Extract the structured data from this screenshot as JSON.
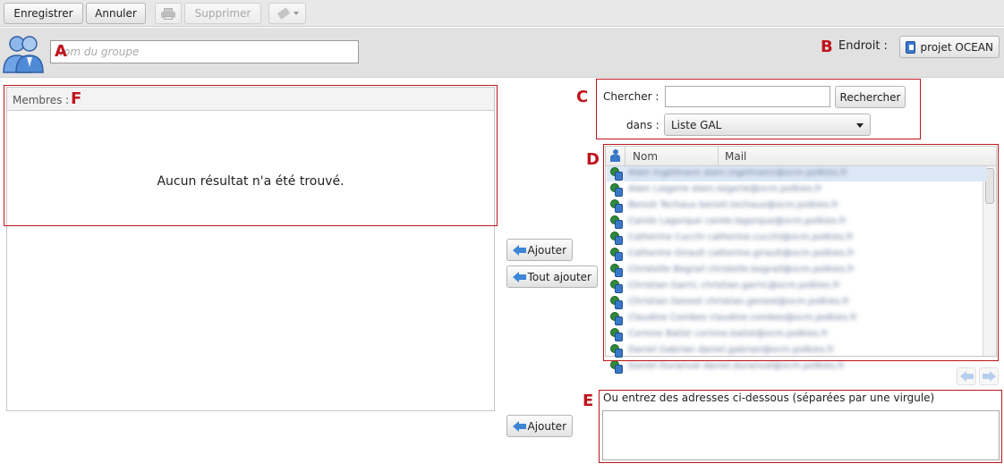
{
  "toolbar": {
    "save_label": "Enregistrer",
    "cancel_label": "Annuler",
    "delete_label": "Supprimer"
  },
  "header": {
    "group_name_placeholder": "Nom du groupe",
    "location_label": "Endroit :",
    "location_value": "projet OCEAN"
  },
  "members": {
    "header": "Membres :",
    "empty_text": "Aucun résultat n'a été trouvé."
  },
  "search": {
    "search_label": "Chercher :",
    "search_value": "",
    "search_button": "Rechercher",
    "in_label": "dans :",
    "source_selected": "Liste GAL"
  },
  "results": {
    "columns": [
      "Nom",
      "Mail"
    ],
    "rows": [
      {
        "name": "Alain Ingelmann",
        "mail": "alain.ingelmann@ocm.polkies.fr"
      },
      {
        "name": "Alain Laigerie",
        "mail": "alain.laigerie@ocm.polkies.fr"
      },
      {
        "name": "Benoit Techaux",
        "mail": "benoit.techaux@ocm.polkies.fr"
      },
      {
        "name": "Carole Lagorque",
        "mail": "carole.lagorque@ocm.polkies.fr"
      },
      {
        "name": "Catherine Cucchi",
        "mail": "catherine.cucchi@ocm.polkies.fr"
      },
      {
        "name": "Catherine Girault",
        "mail": "catherine.girault@ocm.polkies.fr"
      },
      {
        "name": "Christelle Begrail",
        "mail": "christelle.begrail@ocm.polkies.fr"
      },
      {
        "name": "Christian Garric",
        "mail": "christian.garric@ocm.polkies.fr"
      },
      {
        "name": "Christian Genest",
        "mail": "christian.genest@ocm.polkies.fr"
      },
      {
        "name": "Claudine Combes",
        "mail": "claudine.combes@ocm.polkies.fr"
      },
      {
        "name": "Corinne Batist",
        "mail": "corinne.batist@ocm.polkies.fr"
      },
      {
        "name": "Daniel Gabrian",
        "mail": "daniel.gabrian@ocm.polkies.fr"
      },
      {
        "name": "Daniel Duranval",
        "mail": "daniel.duranval@ocm.polkies.fr"
      }
    ]
  },
  "actions": {
    "add_label": "Ajouter",
    "add_all_label": "Tout ajouter",
    "add_addresses_label": "Ajouter"
  },
  "addresses": {
    "label": "Ou entrez des adresses ci-dessous (séparées par une virgule)",
    "value": ""
  },
  "annotations": [
    "A",
    "B",
    "C",
    "D",
    "E",
    "F"
  ],
  "colors": {
    "annotation_red": "#c0141c",
    "arrow_blue": "#3d86d6",
    "selected_row": "#dde8f6"
  }
}
